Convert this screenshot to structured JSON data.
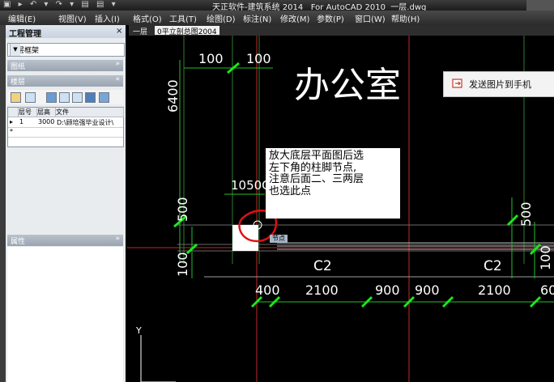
{
  "window": {
    "title": "天正软件-建筑系统 2014   For AutoCAD 2010  一层.dwg",
    "quick_access": "▣ ▸ ↶ ▾ ↷ ▾ ▤ ▤ ▾"
  },
  "menu": [
    {
      "label": "编辑(E)"
    },
    {
      "label": "视图(V)"
    },
    {
      "label": "插入(I)"
    },
    {
      "label": "格式(O)"
    },
    {
      "label": "工具(T)"
    },
    {
      "label": "绘图(D)"
    },
    {
      "label": "标注(N)"
    },
    {
      "label": "修改(M)"
    },
    {
      "label": "参数(P)"
    },
    {
      "label": "窗口(W)"
    },
    {
      "label": "帮助(H)"
    }
  ],
  "panel": {
    "title": "工程管理",
    "close": "×",
    "project_select": "三层框架",
    "sections": {
      "drawings": "图纸",
      "floors": "楼层",
      "properties": "属性"
    },
    "collapse_glyph": "»",
    "expand_glyph": "«",
    "table": {
      "headers": [
        "层号",
        "层高",
        "文件"
      ],
      "rows": [
        {
          "marker": "▸",
          "floor_no": "1",
          "height": "3000",
          "file": "D:\\顾培强毕业设计\\"
        },
        {
          "marker": "*",
          "floor_no": "",
          "height": "",
          "file": ""
        }
      ]
    }
  },
  "tabs": [
    {
      "label": "一层"
    },
    {
      "label": "0平立剖总图2004"
    }
  ],
  "drawing": {
    "room_label": "办公室",
    "callout_lines": [
      "放大底层平面图后选",
      "左下角的柱脚节点,",
      "注意后面二、三两层",
      "也选此点"
    ],
    "snap_tooltip": "节点",
    "column_label": "C2",
    "dims_top": [
      "100",
      "100"
    ],
    "dim_left_vertical": "6400",
    "dim_left_500": "500",
    "dim_left_100": "100",
    "dim_right_500": "500",
    "dim_right_100": "100",
    "dim_col": "1050C",
    "dims_bottom": [
      "400",
      "2100",
      "900",
      "900",
      "2100",
      "60"
    ],
    "axis_y": "Y"
  },
  "send_button": {
    "label": "发送图片到手机"
  },
  "colors": {
    "canvas": "#000000",
    "grid_red": "#c62828",
    "wall_green": "#2e7d32",
    "dim_green": "#22c02c",
    "tick_green": "#18e818",
    "text_white": "#ffffff"
  }
}
